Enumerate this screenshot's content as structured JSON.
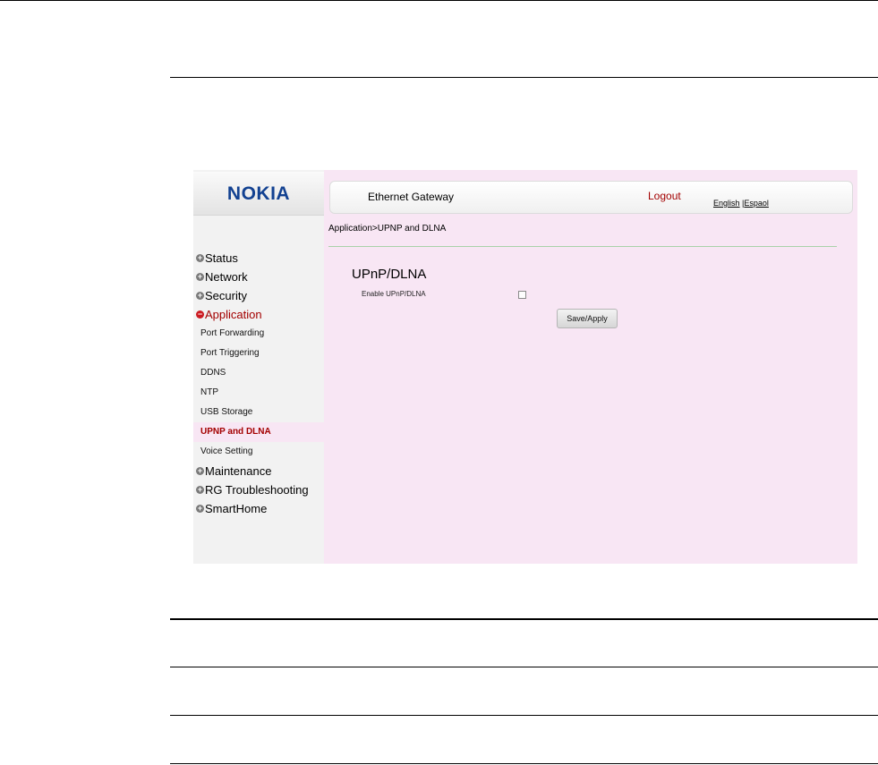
{
  "header": {
    "logo_text": "NOKIA",
    "gateway_title": "Ethernet Gateway",
    "logout_label": "Logout",
    "lang_english": "English",
    "lang_separator": " |",
    "lang_spanish": "Espaol"
  },
  "breadcrumb": "Application>UPNP and DLNA",
  "sidebar": {
    "status": "Status",
    "network": "Network",
    "security": "Security",
    "application": "Application",
    "sub_port_forwarding": "Port Forwarding",
    "sub_port_triggering": "Port Triggering",
    "sub_ddns": "DDNS",
    "sub_ntp": "NTP",
    "sub_usb_storage": "USB Storage",
    "sub_upnp_dlna": "UPNP and DLNA",
    "sub_voice_setting": "Voice Setting",
    "maintenance": "Maintenance",
    "rg_troubleshooting": "RG Troubleshooting",
    "smarthome": "SmartHome",
    "expand_glyph": "+",
    "collapse_glyph": "−"
  },
  "main": {
    "section_title": "UPnP/DLNA",
    "enable_label": "Enable UPnP/DLNA",
    "save_label": "Save/Apply"
  },
  "colors": {
    "content_bg": "#f8e6f4",
    "sidebar_bg": "#f2f2f2",
    "brand_blue": "#124191",
    "active_red": "#a30000"
  }
}
